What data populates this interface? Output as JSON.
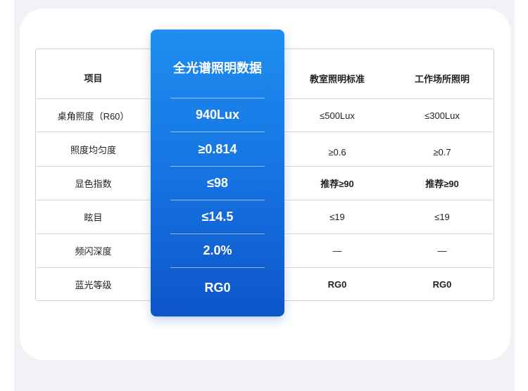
{
  "table": {
    "headers": {
      "item": "项目",
      "full_spectrum": "全光谱照明数据",
      "classroom": "教室照明标准",
      "workplace": "工作场所照明"
    },
    "rows": [
      {
        "item": "桌角照度（R60）",
        "full_spectrum": "940Lux",
        "classroom": "≤500Lux",
        "workplace": "≤300Lux"
      },
      {
        "item": "照度均匀度",
        "full_spectrum": "≥0.814",
        "classroom": "≥0.6",
        "workplace": "≥0.7"
      },
      {
        "item": "显色指数",
        "full_spectrum": "≤98",
        "classroom": "推荐≥90",
        "workplace": "推荐≥90"
      },
      {
        "item": "眩目",
        "full_spectrum": "≤14.5",
        "classroom": "≤19",
        "workplace": "≤19"
      },
      {
        "item": "频闪深度",
        "full_spectrum": "2.0%",
        "classroom": "—",
        "workplace": "—"
      },
      {
        "item": "蓝光等级",
        "full_spectrum": "RG0",
        "classroom": "RG0",
        "workplace": "RG0"
      }
    ]
  },
  "colors": {
    "accent_top": "#1e8ef1",
    "accent_bottom": "#0d55c9",
    "background": "#f1f2f5",
    "text": "#222222"
  }
}
